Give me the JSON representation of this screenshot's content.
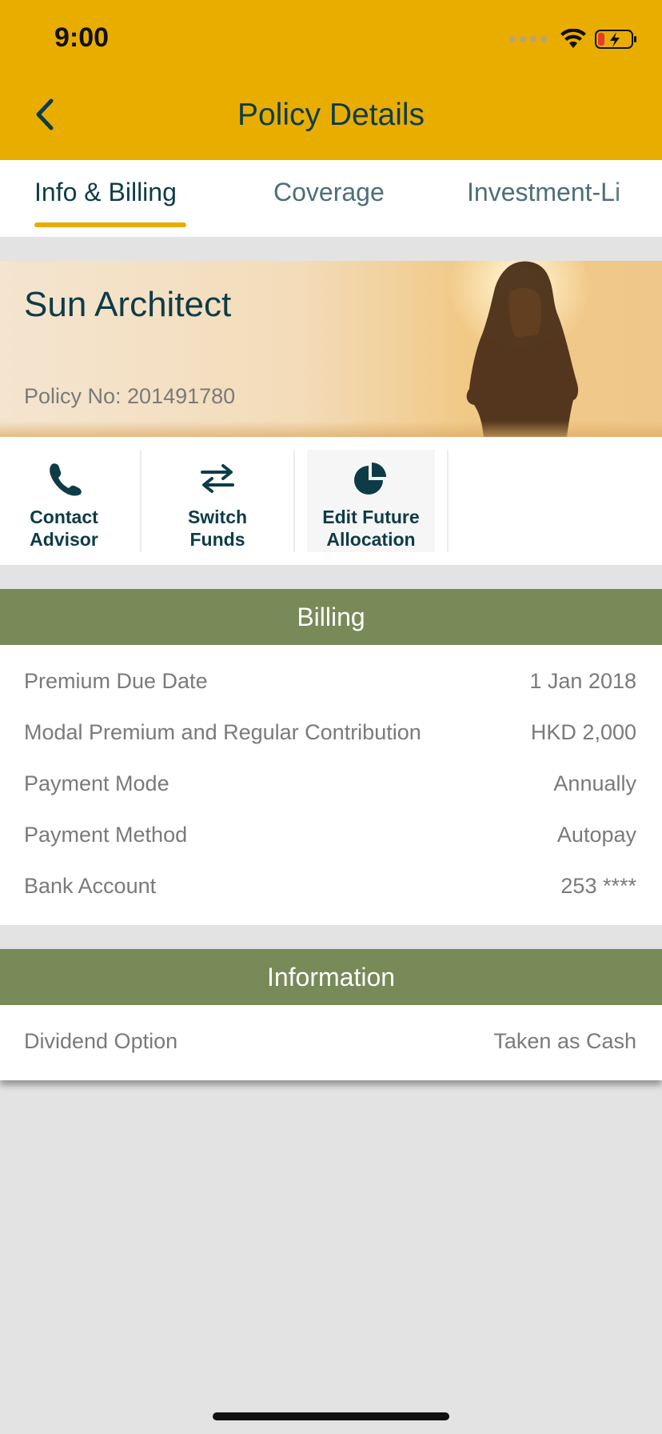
{
  "status_bar": {
    "time": "9:00"
  },
  "header": {
    "title": "Policy Details"
  },
  "tabs": [
    {
      "label": "Info & Billing",
      "active": true
    },
    {
      "label": "Coverage",
      "active": false
    },
    {
      "label": "Investment-Li",
      "active": false
    }
  ],
  "policy": {
    "name": "Sun Architect",
    "number_text": "Policy No: 201491780"
  },
  "actions": [
    {
      "label": "Contact\nAdvisor",
      "icon": "phone-icon"
    },
    {
      "label": "Switch\nFunds",
      "icon": "switch-arrows-icon"
    },
    {
      "label": "Edit Future\nAllocation",
      "icon": "pie-chart-icon"
    }
  ],
  "billing": {
    "heading": "Billing",
    "rows": [
      {
        "label": "Premium Due Date",
        "value": "1 Jan 2018"
      },
      {
        "label": "Modal Premium and Regular Contribution",
        "value": "HKD 2,000"
      },
      {
        "label": "Payment Mode",
        "value": "Annually"
      },
      {
        "label": "Payment Method",
        "value": "Autopay"
      },
      {
        "label": "Bank Account",
        "value": "253 ****"
      }
    ]
  },
  "information": {
    "heading": "Information",
    "rows": [
      {
        "label": "Dividend Option",
        "value": "Taken as Cash"
      }
    ]
  },
  "colors": {
    "brand_yellow": "#e9ad00",
    "navy": "#0d3c47",
    "section_green": "#778a58",
    "text_gray": "#7a7a7a"
  }
}
